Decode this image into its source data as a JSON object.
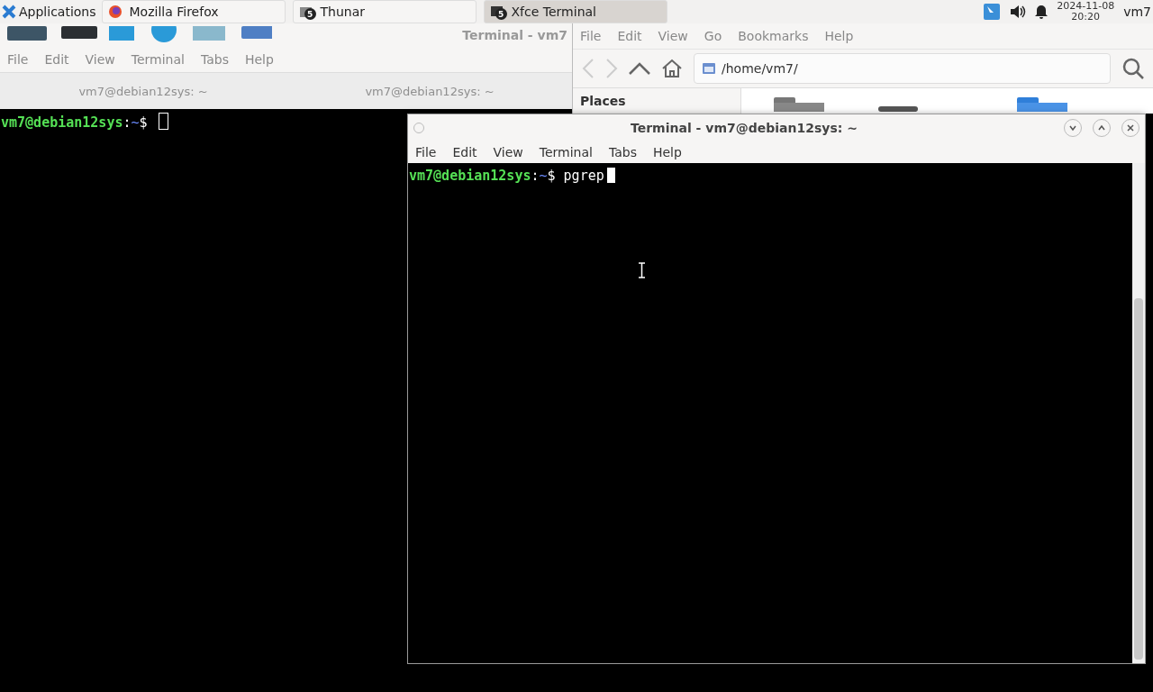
{
  "taskbar": {
    "applications_menu": "Applications",
    "tasks": [
      {
        "label": "Mozilla Firefox",
        "kind": "firefox",
        "selected": false
      },
      {
        "label": "Thunar",
        "kind": "files",
        "badge": "5",
        "selected": false
      },
      {
        "label": "Xfce Terminal",
        "kind": "terminal",
        "badge": "5",
        "selected": true
      }
    ],
    "clock": {
      "date": "2024-11-08",
      "time": "20:20"
    },
    "user": "vm7"
  },
  "back_terminal": {
    "title": "Terminal - vm7",
    "active": false,
    "menu": [
      "File",
      "Edit",
      "View",
      "Terminal",
      "Tabs",
      "Help"
    ],
    "tabs": [
      "vm7@debian12sys: ~",
      "vm7@debian12sys: ~"
    ],
    "prompt": {
      "user_host": "vm7@debian12sys",
      "separator": ":",
      "path": "~",
      "symbol": "$"
    }
  },
  "file_manager": {
    "active": false,
    "menu": [
      "File",
      "Edit",
      "View",
      "Go",
      "Bookmarks",
      "Help"
    ],
    "location": "/home/vm7/",
    "places_heading": "Places"
  },
  "front_terminal": {
    "title": "Terminal - vm7@debian12sys: ~",
    "active": true,
    "menu": [
      "File",
      "Edit",
      "View",
      "Terminal",
      "Tabs",
      "Help"
    ],
    "prompt": {
      "user_host": "vm7@debian12sys",
      "separator": ":",
      "path": "~",
      "symbol": "$"
    },
    "command": "pgrep"
  }
}
